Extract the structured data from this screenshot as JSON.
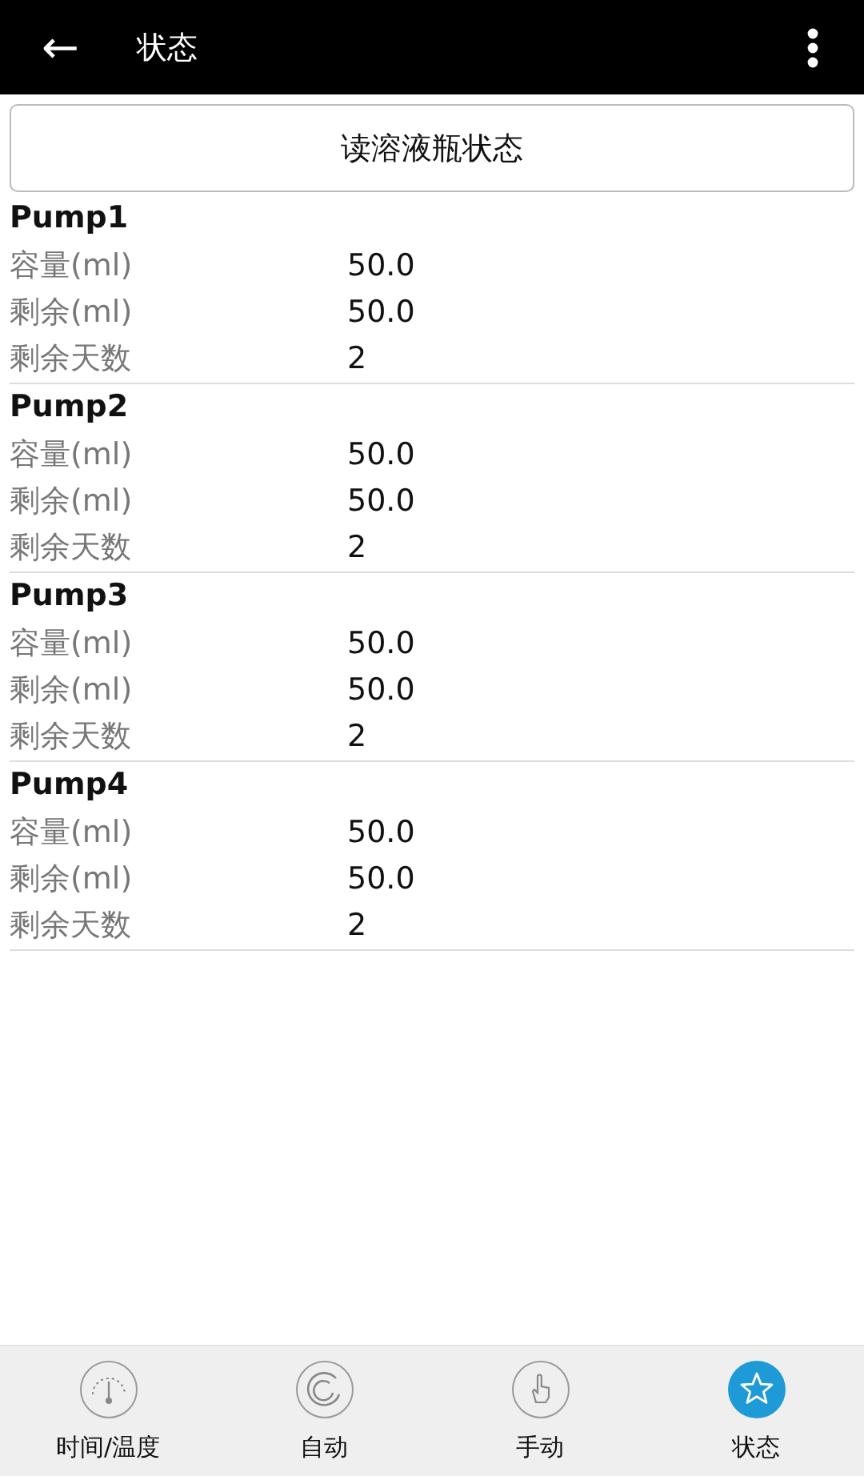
{
  "header": {
    "back_icon": "←",
    "title": "状态"
  },
  "read_button": "读溶液瓶状态",
  "pumps": [
    {
      "name": "Pump1",
      "fields": [
        {
          "label": "容量(ml)",
          "value": "50.0"
        },
        {
          "label": "剩余(ml)",
          "value": "50.0"
        },
        {
          "label": "剩余天数",
          "value": "2"
        }
      ]
    },
    {
      "name": "Pump2",
      "fields": [
        {
          "label": "容量(ml)",
          "value": "50.0"
        },
        {
          "label": "剩余(ml)",
          "value": "50.0"
        },
        {
          "label": "剩余天数",
          "value": "2"
        }
      ]
    },
    {
      "name": "Pump3",
      "fields": [
        {
          "label": "容量(ml)",
          "value": "50.0"
        },
        {
          "label": "剩余(ml)",
          "value": "50.0"
        },
        {
          "label": "剩余天数",
          "value": "2"
        }
      ]
    },
    {
      "name": "Pump4",
      "fields": [
        {
          "label": "容量(ml)",
          "value": "50.0"
        },
        {
          "label": "剩余(ml)",
          "value": "50.0"
        },
        {
          "label": "剩余天数",
          "value": "2"
        }
      ]
    }
  ],
  "tabs": [
    {
      "label": "时间/温度",
      "kind": "gauge",
      "selected": false
    },
    {
      "label": "自动",
      "kind": "swirl",
      "selected": false
    },
    {
      "label": "手动",
      "kind": "hand",
      "selected": false
    },
    {
      "label": "状态",
      "kind": "star",
      "selected": true
    }
  ]
}
